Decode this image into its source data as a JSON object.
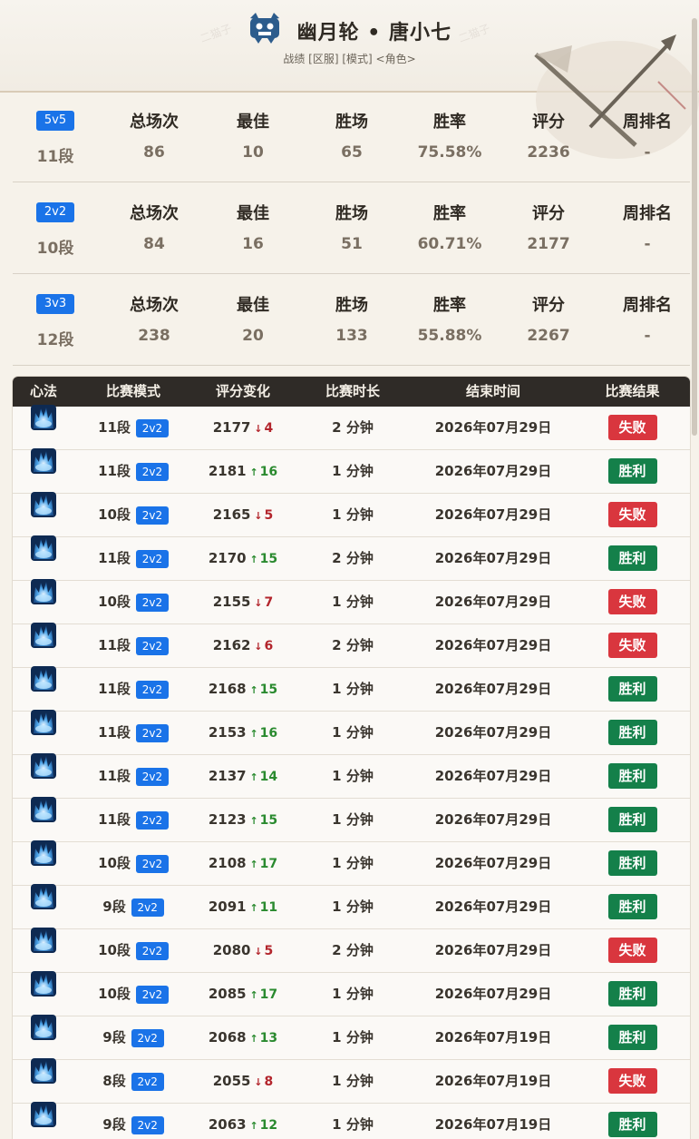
{
  "header": {
    "name": "幽月轮 • 唐小七",
    "subtitle": "战绩 [区服] [模式] <角色>"
  },
  "stats": [
    {
      "mode": "5v5",
      "tier": "11段",
      "total": "86",
      "best": "10",
      "wins": "65",
      "winrate": "75.58%",
      "score": "2236",
      "weekly": "-"
    },
    {
      "mode": "2v2",
      "tier": "10段",
      "total": "84",
      "best": "16",
      "wins": "51",
      "winrate": "60.71%",
      "score": "2177",
      "weekly": "-"
    },
    {
      "mode": "3v3",
      "tier": "12段",
      "total": "238",
      "best": "20",
      "wins": "133",
      "winrate": "55.88%",
      "score": "2267",
      "weekly": "-"
    }
  ],
  "stat_labels": {
    "total": "总场次",
    "best": "最佳",
    "wins": "胜场",
    "winrate": "胜率",
    "score": "评分",
    "weekly": "周排名"
  },
  "table": {
    "headers": [
      "心法",
      "比赛模式",
      "评分变化",
      "比赛时长",
      "结束时间",
      "比赛结果"
    ],
    "rows": [
      {
        "tier": "11段",
        "mode": "2v2",
        "score": "2177",
        "dir": "down",
        "delta": "4",
        "duration": "2 分钟",
        "end": "2026年07月29日",
        "result": "失败"
      },
      {
        "tier": "11段",
        "mode": "2v2",
        "score": "2181",
        "dir": "up",
        "delta": "16",
        "duration": "1 分钟",
        "end": "2026年07月29日",
        "result": "胜利"
      },
      {
        "tier": "10段",
        "mode": "2v2",
        "score": "2165",
        "dir": "down",
        "delta": "5",
        "duration": "1 分钟",
        "end": "2026年07月29日",
        "result": "失败"
      },
      {
        "tier": "11段",
        "mode": "2v2",
        "score": "2170",
        "dir": "up",
        "delta": "15",
        "duration": "2 分钟",
        "end": "2026年07月29日",
        "result": "胜利"
      },
      {
        "tier": "10段",
        "mode": "2v2",
        "score": "2155",
        "dir": "down",
        "delta": "7",
        "duration": "1 分钟",
        "end": "2026年07月29日",
        "result": "失败"
      },
      {
        "tier": "11段",
        "mode": "2v2",
        "score": "2162",
        "dir": "down",
        "delta": "6",
        "duration": "2 分钟",
        "end": "2026年07月29日",
        "result": "失败"
      },
      {
        "tier": "11段",
        "mode": "2v2",
        "score": "2168",
        "dir": "up",
        "delta": "15",
        "duration": "1 分钟",
        "end": "2026年07月29日",
        "result": "胜利"
      },
      {
        "tier": "11段",
        "mode": "2v2",
        "score": "2153",
        "dir": "up",
        "delta": "16",
        "duration": "1 分钟",
        "end": "2026年07月29日",
        "result": "胜利"
      },
      {
        "tier": "11段",
        "mode": "2v2",
        "score": "2137",
        "dir": "up",
        "delta": "14",
        "duration": "1 分钟",
        "end": "2026年07月29日",
        "result": "胜利"
      },
      {
        "tier": "11段",
        "mode": "2v2",
        "score": "2123",
        "dir": "up",
        "delta": "15",
        "duration": "1 分钟",
        "end": "2026年07月29日",
        "result": "胜利"
      },
      {
        "tier": "10段",
        "mode": "2v2",
        "score": "2108",
        "dir": "up",
        "delta": "17",
        "duration": "1 分钟",
        "end": "2026年07月29日",
        "result": "胜利"
      },
      {
        "tier": "9段",
        "mode": "2v2",
        "score": "2091",
        "dir": "up",
        "delta": "11",
        "duration": "1 分钟",
        "end": "2026年07月29日",
        "result": "胜利"
      },
      {
        "tier": "10段",
        "mode": "2v2",
        "score": "2080",
        "dir": "down",
        "delta": "5",
        "duration": "2 分钟",
        "end": "2026年07月29日",
        "result": "失败"
      },
      {
        "tier": "10段",
        "mode": "2v2",
        "score": "2085",
        "dir": "up",
        "delta": "17",
        "duration": "1 分钟",
        "end": "2026年07月29日",
        "result": "胜利"
      },
      {
        "tier": "9段",
        "mode": "2v2",
        "score": "2068",
        "dir": "up",
        "delta": "13",
        "duration": "1 分钟",
        "end": "2026年07月19日",
        "result": "胜利"
      },
      {
        "tier": "8段",
        "mode": "2v2",
        "score": "2055",
        "dir": "down",
        "delta": "8",
        "duration": "1 分钟",
        "end": "2026年07月19日",
        "result": "失败"
      },
      {
        "tier": "9段",
        "mode": "2v2",
        "score": "2063",
        "dir": "up",
        "delta": "12",
        "duration": "1 分钟",
        "end": "2026年07月19日",
        "result": "胜利"
      }
    ]
  },
  "colors": {
    "badge": "#1a73e8",
    "win": "#14804a",
    "lose": "#d9363e",
    "header_bg": "#2f2b27",
    "up": "#2a8a2f",
    "down": "#b3252c"
  },
  "icons": {
    "xinfa": "xinfa-flame-icon",
    "logo": "school-logo-icon",
    "up": "arrow-up-icon",
    "down": "arrow-down-icon"
  }
}
